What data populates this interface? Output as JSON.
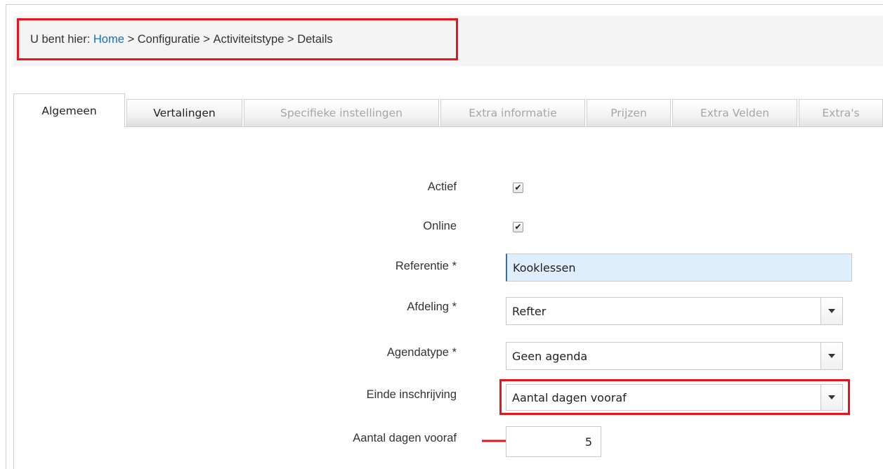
{
  "breadcrumb": {
    "prefix": "U bent hier: ",
    "home": "Home",
    "sep1": " > ",
    "item1": "Configuratie",
    "sep2": " > ",
    "item2": "Activiteitstype",
    "sep3": " > ",
    "item3": "Details"
  },
  "tabs": [
    {
      "label": "Algemeen",
      "state": "active"
    },
    {
      "label": "Vertalingen",
      "state": "enabled"
    },
    {
      "label": "Specifieke instellingen",
      "state": "disabled"
    },
    {
      "label": "Extra informatie",
      "state": "disabled"
    },
    {
      "label": "Prijzen",
      "state": "disabled"
    },
    {
      "label": "Extra Velden",
      "state": "disabled"
    },
    {
      "label": "Extra's",
      "state": "disabled"
    }
  ],
  "form": {
    "actief": {
      "label": "Actief",
      "checked": true,
      "mark": "✔"
    },
    "online": {
      "label": "Online",
      "checked": true,
      "mark": "✔"
    },
    "referentie": {
      "label": "Referentie *",
      "value": "Kooklessen"
    },
    "afdeling": {
      "label": "Afdeling *",
      "value": "Refter"
    },
    "agendatype": {
      "label": "Agendatype *",
      "value": "Geen agenda"
    },
    "einde_inschrijving": {
      "label": "Einde inschrijving",
      "value": "Aantal dagen vooraf"
    },
    "aantal_dagen": {
      "label": "Aantal dagen vooraf",
      "value": "5"
    }
  },
  "colors": {
    "highlight": "#e8141c",
    "link": "#1a6fb0",
    "ref_bg": "#dfeefc"
  }
}
